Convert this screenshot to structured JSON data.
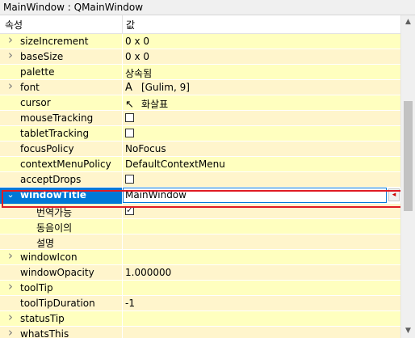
{
  "window": {
    "title": "MainWindow : QMainWindow"
  },
  "header": {
    "property": "속성",
    "value": "값"
  },
  "rows": [
    {
      "name": "sizeIncrement",
      "value": "0 x 0",
      "expandable": true
    },
    {
      "name": "baseSize",
      "value": "0 x 0",
      "expandable": true
    },
    {
      "name": "palette",
      "value": "상속됨",
      "expandable": false
    },
    {
      "name": "font",
      "value": "[Gulim, 9]",
      "icon": "font-A-icon",
      "icon_glyph": "A",
      "expandable": true
    },
    {
      "name": "cursor",
      "value": "화살표",
      "icon": "arrow-cursor-icon",
      "icon_glyph": "↖",
      "expandable": false
    },
    {
      "name": "mouseTracking",
      "checked": false
    },
    {
      "name": "tabletTracking",
      "checked": false
    },
    {
      "name": "focusPolicy",
      "value": "NoFocus"
    },
    {
      "name": "contextMenuPolicy",
      "value": "DefaultContextMenu"
    },
    {
      "name": "acceptDrops",
      "checked": false
    },
    {
      "name": "windowTitle",
      "value": "MainWindow",
      "selected": true,
      "expanded": true
    },
    {
      "name": "번역가능",
      "checked": true,
      "sub": true
    },
    {
      "name": "동음이의",
      "sub": true
    },
    {
      "name": "설명",
      "sub": true
    },
    {
      "name": "windowIcon",
      "expandable": true
    },
    {
      "name": "windowOpacity",
      "value": "1.000000"
    },
    {
      "name": "toolTip",
      "expandable": true
    },
    {
      "name": "toolTipDuration",
      "value": "-1"
    },
    {
      "name": "statusTip",
      "expandable": true
    },
    {
      "name": "whatsThis",
      "expandable": true
    }
  ],
  "colors": {
    "row_a": "#ffffbf",
    "row_b": "#fff5cc",
    "selection": "#0078d7",
    "highlight_frame": "#e01b24"
  },
  "icons": {
    "expander_collapsed": "chevron-right-icon",
    "expander_expanded": "chevron-down-icon",
    "reset": "reset-arrow-icon"
  }
}
